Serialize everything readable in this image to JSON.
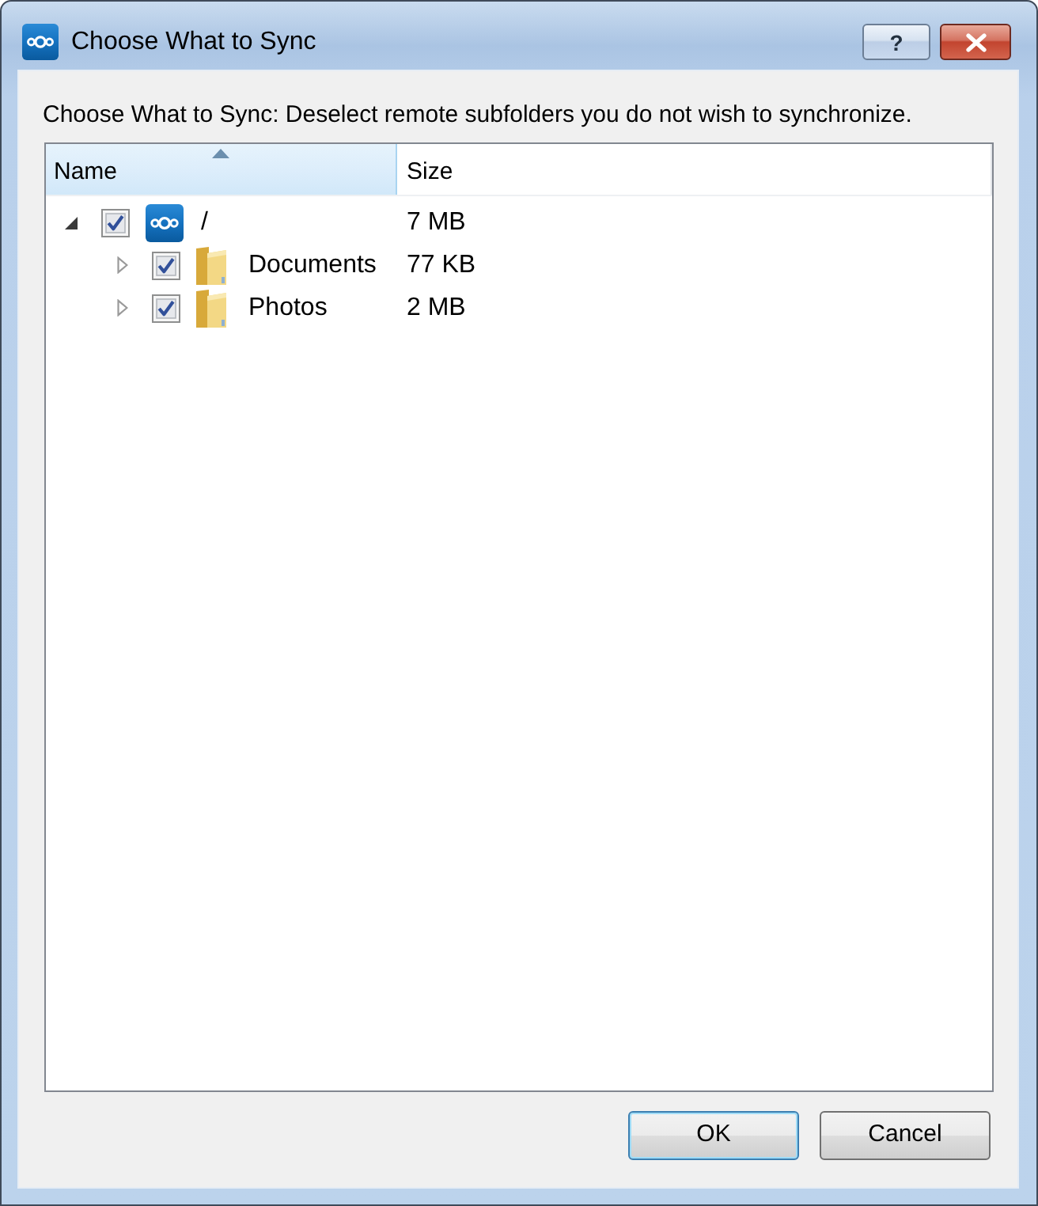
{
  "window": {
    "title": "Choose What to Sync",
    "help_button": "?"
  },
  "instruction": "Choose What to Sync: Deselect remote subfolders you do not wish to synchronize.",
  "tree": {
    "columns": [
      {
        "label": "Name",
        "sorted": true
      },
      {
        "label": "Size",
        "sorted": false
      }
    ],
    "rows": [
      {
        "kind": "root",
        "name": "/",
        "size": "7 MB",
        "checked": true,
        "expanded": true,
        "children": [
          {
            "kind": "folder",
            "name": "Documents",
            "size": "77 KB",
            "checked": true,
            "expanded": false
          },
          {
            "kind": "folder",
            "name": "Photos",
            "size": "2 MB",
            "checked": true,
            "expanded": false
          }
        ]
      }
    ]
  },
  "buttons": [
    {
      "label": "OK",
      "default": true
    },
    {
      "label": "Cancel",
      "default": false
    }
  ]
}
